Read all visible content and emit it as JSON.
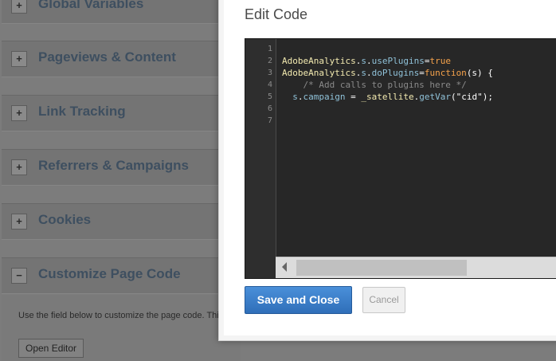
{
  "background": {
    "sections": [
      {
        "toggle": "+",
        "title": "Global Variables"
      },
      {
        "toggle": "+",
        "title": "Pageviews & Content"
      },
      {
        "toggle": "+",
        "title": "Link Tracking"
      },
      {
        "toggle": "+",
        "title": "Referrers & Campaigns"
      },
      {
        "toggle": "+",
        "title": "Cookies"
      },
      {
        "toggle": "−",
        "title": "Customize Page Code"
      }
    ],
    "expanded": {
      "description": "Use the field below to customize the page code. This",
      "open_editor_label": "Open Editor"
    }
  },
  "modal": {
    "title": "Edit Code",
    "line_numbers": [
      "1",
      "2",
      "3",
      "4",
      "5",
      "6",
      "7"
    ],
    "code": {
      "l2_obj": "AdobeAnalytics",
      "l2_dot1": ".",
      "l2_s": "s",
      "l2_dot2": ".",
      "l2_prop": "usePlugins",
      "l2_eq": "=",
      "l2_val": "true",
      "l3_obj": "AdobeAnalytics",
      "l3_dot1": ".",
      "l3_s": "s",
      "l3_dot2": ".",
      "l3_prop": "doPlugins",
      "l3_eq": "=",
      "l3_kw": "function",
      "l3_rest": "(s) {",
      "l4_comment": "    /* Add calls to plugins here */",
      "l5_indent": "  ",
      "l5_s": "s",
      "l5_dot": ".",
      "l5_prop": "campaign",
      "l5_eq": " = ",
      "l5_sat": "_satellite",
      "l5_dot2": ".",
      "l5_fn": "getVar",
      "l5_args": "(\"cid\");"
    },
    "save_label": "Save and Close",
    "cancel_label": "Cancel"
  },
  "colors": {
    "primary_button": "#3a7fcb",
    "editor_background": "#272727",
    "keyword": "#f5a24b",
    "object": "#f3eab0",
    "property": "#8fc1d8"
  }
}
